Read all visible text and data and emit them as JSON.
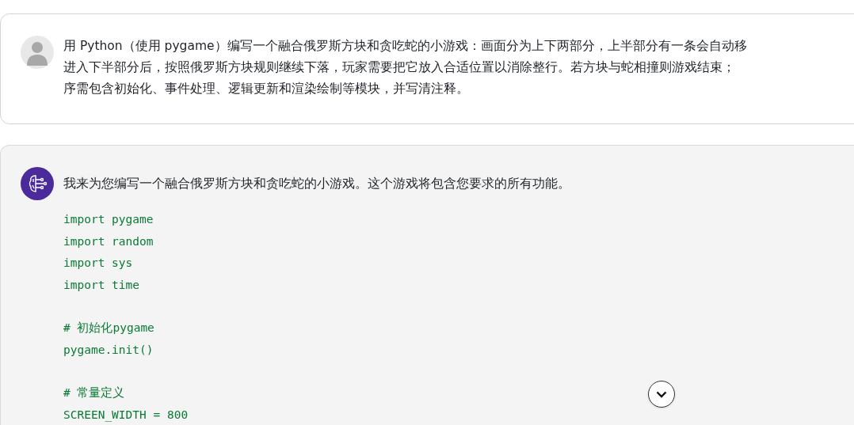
{
  "user_message": {
    "lines": [
      "用 Python（使用 pygame）编写一个融合俄罗斯方块和贪吃蛇的小游戏：画面分为上下两部分，上半部分有一条会自动移",
      "进入下半部分后，按照俄罗斯方块规则继续下落，玩家需要把它放入合适位置以消除整行。若方块与蛇相撞则游戏结束；",
      "序需包含初始化、事件处理、逻辑更新和渲染绘制等模块，并写清注释。"
    ]
  },
  "assistant_message": {
    "intro": "我来为您编写一个融合俄罗斯方块和贪吃蛇的小游戏。这个游戏将包含您要求的所有功能。",
    "code_blocks": [
      [
        "import pygame",
        "import random",
        "import sys",
        "import time"
      ],
      [
        "# 初始化pygame",
        "pygame.init()"
      ],
      [
        "# 常量定义",
        "SCREEN_WIDTH = 800"
      ]
    ]
  }
}
